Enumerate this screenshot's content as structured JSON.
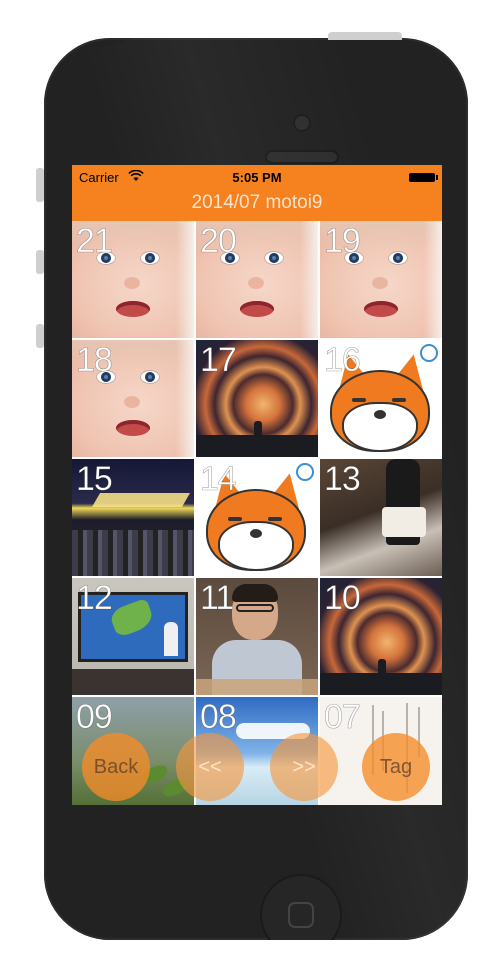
{
  "status_bar": {
    "carrier": "Carrier",
    "time": "5:05 PM",
    "wifi_icon": "wifi-icon",
    "battery_icon": "battery-icon"
  },
  "nav": {
    "title": "2014/07 motoi9"
  },
  "colors": {
    "accent": "#f5821f",
    "button": "#f58c28",
    "phone_body": "#222222"
  },
  "grid": {
    "cells": [
      {
        "label": "21",
        "kind": "baby"
      },
      {
        "label": "20",
        "kind": "baby"
      },
      {
        "label": "19",
        "kind": "baby"
      },
      {
        "label": "18",
        "kind": "baby"
      },
      {
        "label": "17",
        "kind": "spiral-sky"
      },
      {
        "label": "16",
        "kind": "fox"
      },
      {
        "label": "15",
        "kind": "festival"
      },
      {
        "label": "14",
        "kind": "fox"
      },
      {
        "label": "13",
        "kind": "indoor"
      },
      {
        "label": "12",
        "kind": "tv-weather"
      },
      {
        "label": "11",
        "kind": "man"
      },
      {
        "label": "10",
        "kind": "spiral-sky"
      },
      {
        "label": "09",
        "kind": "plant"
      },
      {
        "label": "08",
        "kind": "beach"
      },
      {
        "label": "07",
        "kind": "letter"
      }
    ]
  },
  "buttons": {
    "back": "Back",
    "prev": "<<",
    "next": ">>",
    "tag": "Tag"
  }
}
